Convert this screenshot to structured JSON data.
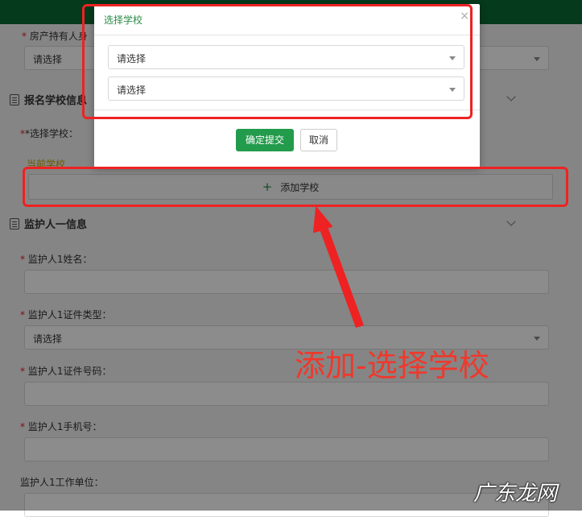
{
  "form": {
    "property_owner_label": "房产持有人身",
    "property_owner_select": "请选择",
    "school_section_title": "报名学校信息",
    "select_school_label": "*选择学校：",
    "current_school_label": "当前学校",
    "add_school_button": "添加学校",
    "guardian_section_title": "监护人一信息",
    "guardian_name_label": "监护人1姓名：",
    "guardian_id_type_label": "监护人1证件类型：",
    "guardian_id_type_select": "请选择",
    "guardian_id_number_label": "监护人1证件号码：",
    "guardian_phone_label": "监护人1手机号：",
    "guardian_employer_label": "监护人1工作单位："
  },
  "modal": {
    "title": "选择学校",
    "close": "×",
    "select1": "请选择",
    "select2": "请选择",
    "confirm": "确定提交",
    "cancel": "取消"
  },
  "annotation": {
    "text": "添加-选择学校",
    "color": "#f0382b"
  },
  "watermark": "广东龙网",
  "colors": {
    "brand_green": "#0b6b33",
    "primary_button": "#239b4c",
    "highlight_red": "#ee2222"
  }
}
